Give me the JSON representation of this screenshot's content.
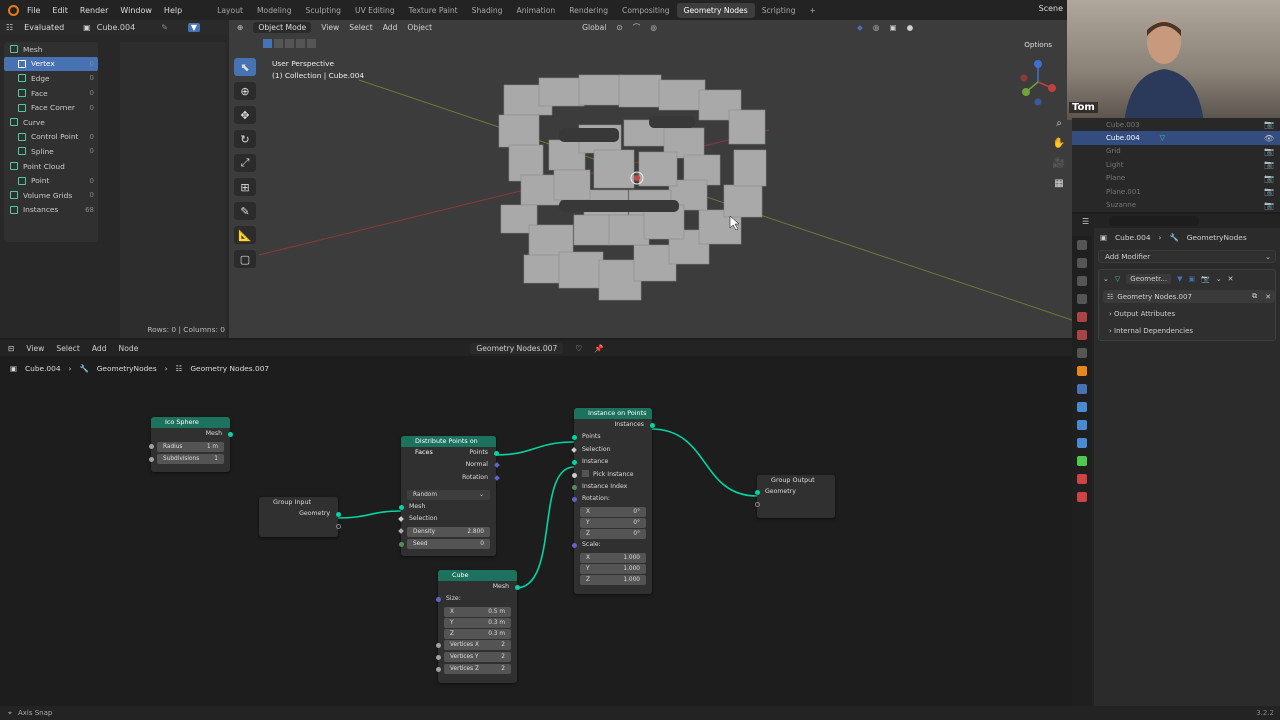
{
  "topbar": {
    "menu": [
      "File",
      "Edit",
      "Render",
      "Window",
      "Help"
    ],
    "workspaces": [
      "Layout",
      "Modeling",
      "Sculpting",
      "UV Editing",
      "Texture Paint",
      "Shading",
      "Animation",
      "Rendering",
      "Compositing",
      "Geometry Nodes",
      "Scripting"
    ],
    "active_workspace": "Geometry Nodes",
    "scene": "Scene"
  },
  "spreadsheet": {
    "mode": "Evaluated",
    "object": "Cube.004",
    "items": [
      {
        "label": "Mesh",
        "count": ""
      },
      {
        "label": "Vertex",
        "count": "0"
      },
      {
        "label": "Edge",
        "count": "0"
      },
      {
        "label": "Face",
        "count": "0"
      },
      {
        "label": "Face Corner",
        "count": "0"
      },
      {
        "label": "Curve",
        "count": ""
      },
      {
        "label": "Control Point",
        "count": "0"
      },
      {
        "label": "Spline",
        "count": "0"
      },
      {
        "label": "Point Cloud",
        "count": ""
      },
      {
        "label": "Point",
        "count": "0"
      },
      {
        "label": "Volume Grids",
        "count": "0"
      },
      {
        "label": "Instances",
        "count": "68"
      }
    ],
    "footer": "Rows: 0  |  Columns: 0"
  },
  "viewport": {
    "mode": "Object Mode",
    "menus": [
      "View",
      "Select",
      "Add",
      "Object"
    ],
    "orientation": "Global",
    "options": "Options",
    "perspective": "User Perspective",
    "collection": "(1) Collection | Cube.004"
  },
  "webcam": {
    "name": "Tom"
  },
  "outliner": {
    "rows": [
      "Cube.003",
      "Cube.004",
      "Grid",
      "Light",
      "Plane",
      "Plane.001",
      "Suzanne"
    ],
    "selected": "Cube.004"
  },
  "properties": {
    "breadcrumb_object": "Cube.004",
    "breadcrumb_modifier": "GeometryNodes",
    "add_modifier": "Add Modifier",
    "modifier_name": "Geometr...",
    "node_group": "Geometry Nodes.007",
    "panels": [
      "Output Attributes",
      "Internal Dependencies"
    ]
  },
  "node_editor": {
    "menus": [
      "View",
      "Select",
      "Add",
      "Node"
    ],
    "node_group": "Geometry Nodes.007",
    "breadcrumb": [
      "Cube.004",
      "GeometryNodes",
      "Geometry Nodes.007"
    ]
  },
  "nodes": {
    "ico_sphere": {
      "title": "Ico Sphere",
      "out": "Mesh",
      "radius_label": "Radius",
      "radius_val": "1 m",
      "subdiv_label": "Subdivisions",
      "subdiv_val": "1"
    },
    "group_input": {
      "title": "Group Input",
      "out": "Geometry"
    },
    "distribute": {
      "title": "Distribute Points on Faces",
      "out_points": "Points",
      "out_normal": "Normal",
      "out_rotation": "Rotation",
      "method": "Random",
      "in_mesh": "Mesh",
      "in_selection": "Selection",
      "density_label": "Density",
      "density_val": "2.800",
      "seed_label": "Seed",
      "seed_val": "0"
    },
    "cube": {
      "title": "Cube",
      "out": "Mesh",
      "size": "Size:",
      "x": "X",
      "xv": "0.5 m",
      "y": "Y",
      "yv": "0.3 m",
      "z": "Z",
      "zv": "0.3 m",
      "vx": "Vertices X",
      "vxv": "2",
      "vy": "Vertices Y",
      "vyv": "2",
      "vz": "Vertices Z",
      "vzv": "2"
    },
    "instance": {
      "title": "Instance on Points",
      "out": "Instances",
      "points": "Points",
      "selection": "Selection",
      "instance": "Instance",
      "pick": "Pick Instance",
      "index": "Instance Index",
      "rotation": "Rotation:",
      "rx": "X",
      "rxv": "0°",
      "ry": "Y",
      "ryv": "0°",
      "rz": "Z",
      "rzv": "0°",
      "scale": "Scale:",
      "sx": "X",
      "sxv": "1.000",
      "sy": "Y",
      "syv": "1.000",
      "sz": "Z",
      "szv": "1.000"
    },
    "group_output": {
      "title": "Group Output",
      "in": "Geometry"
    }
  },
  "status": {
    "left": "Axis Snap",
    "version": "3.2.2"
  }
}
